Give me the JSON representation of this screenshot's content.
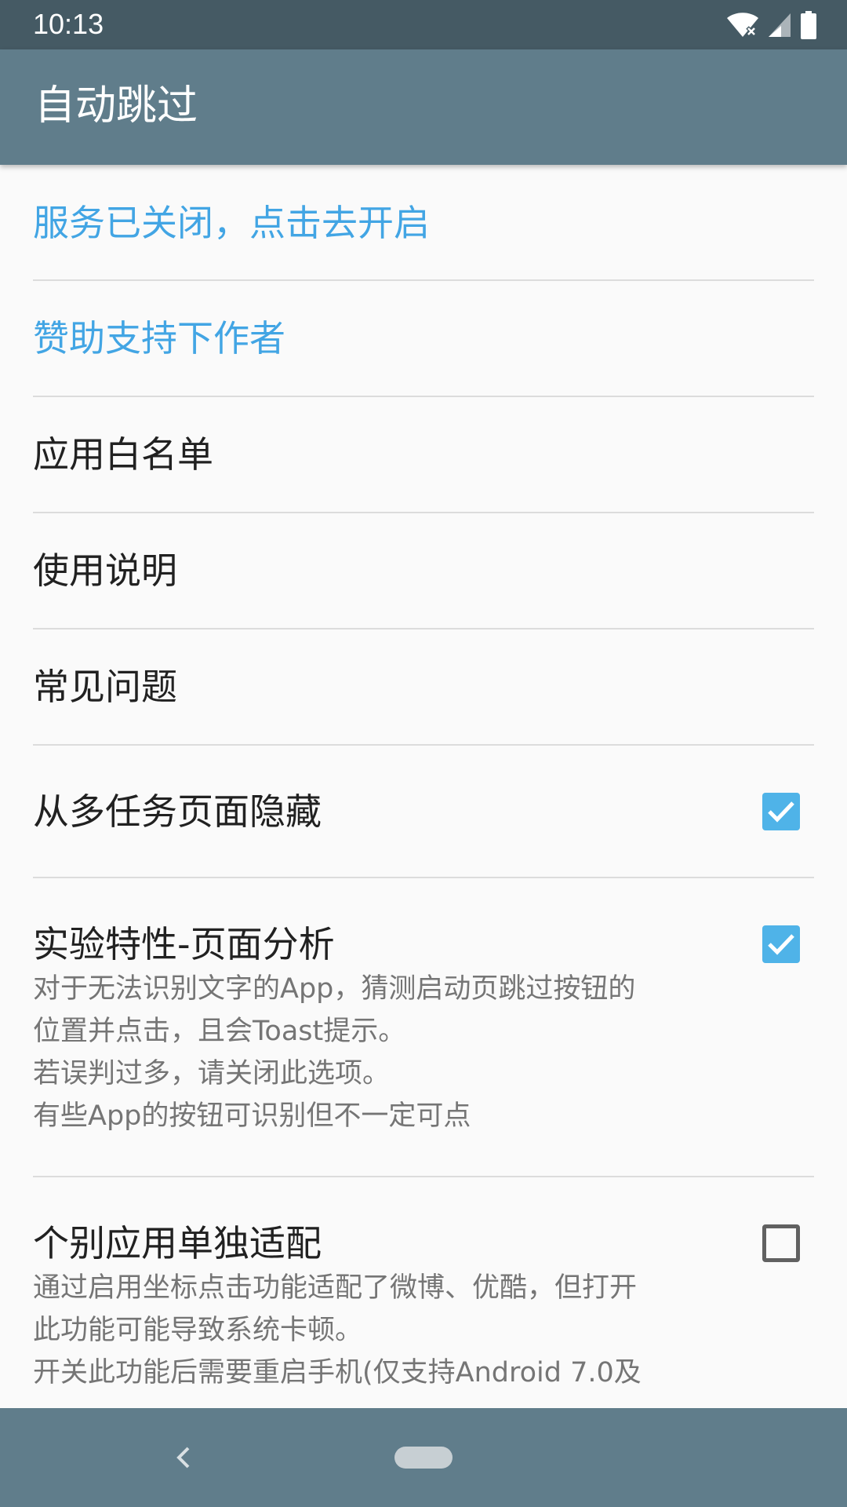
{
  "status_bar": {
    "time": "10:13",
    "icons": [
      "wifi-off-icon",
      "cell-signal-icon",
      "battery-icon"
    ]
  },
  "app_bar": {
    "title": "自动跳过"
  },
  "settings": {
    "service_status": "服务已关闭，点击去开启",
    "sponsor": "赞助支持下作者",
    "whitelist": "应用白名单",
    "instructions": "使用说明",
    "faq": "常见问题",
    "hide_from_recents": {
      "title": "从多任务页面隐藏",
      "checked": true
    },
    "page_analysis": {
      "title": "实验特性-页面分析",
      "checked": true,
      "summary": [
        "对于无法识别文字的App，猜测启动页跳过按钮的",
        "位置并点击，且会Toast提示。",
        "若误判过多，请关闭此选项。",
        "有些App的按钮可识别但不一定可点"
      ]
    },
    "per_app_adapt": {
      "title": "个别应用单独适配",
      "checked": false,
      "summary": [
        "通过启用坐标点击功能适配了微博、优酷，但打开",
        "此功能可能导致系统卡顿。",
        "开关此功能后需要重启手机(仅支持Android 7.0及"
      ]
    }
  },
  "colors": {
    "status_bar": "#455a64",
    "app_bar": "#607d8b",
    "accent_text": "#42a5e4",
    "checkbox_checked": "#4fb3e8",
    "background": "#fafafa"
  },
  "nav_bar": {
    "icons": [
      "back-icon",
      "home-pill-icon"
    ]
  }
}
